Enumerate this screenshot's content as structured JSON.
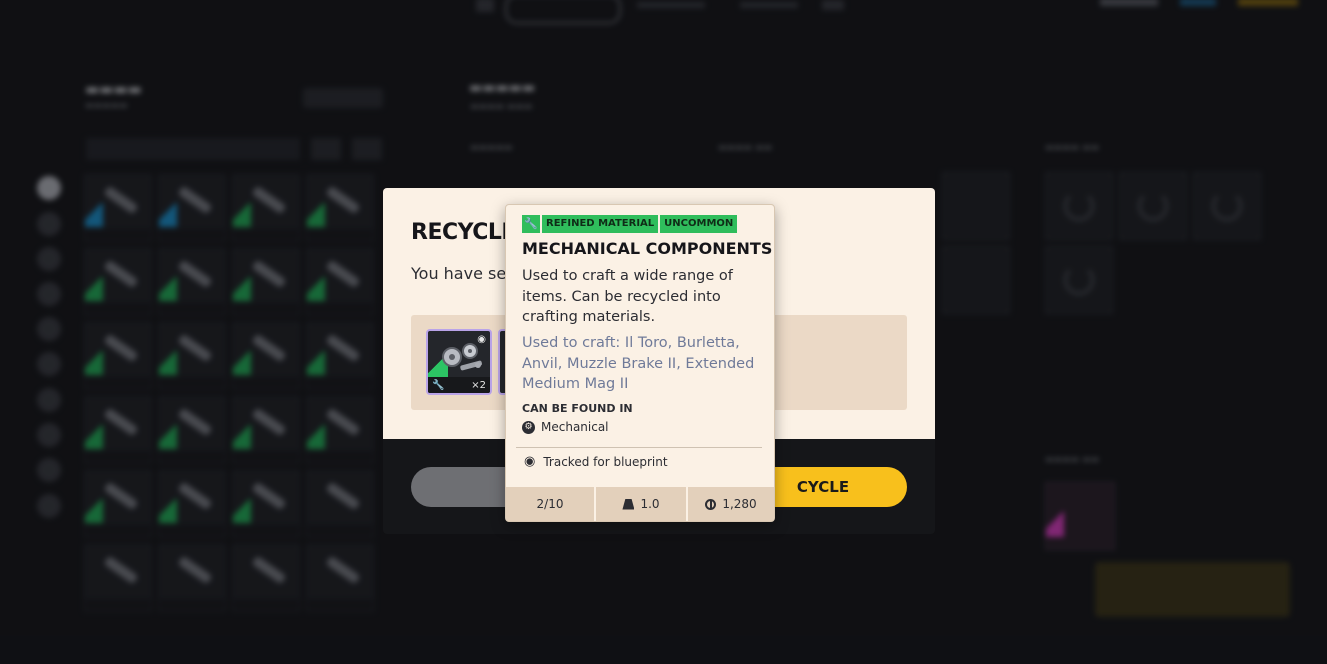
{
  "tooltip": {
    "tags": [
      "REFINED MATERIAL",
      "UNCOMMON"
    ],
    "name": "MECHANICAL COMPONENTS",
    "description": "Used to craft a wide range of items. Can be recycled into crafting materials.",
    "used_to_craft": "Used to craft: Il Toro, Burletta, Anvil, Muzzle Brake II, Extended Medium Mag II",
    "found_in_label": "CAN BE FOUND IN",
    "found_in": "Mechanical",
    "tracked": "Tracked for blueprint",
    "stack": "2/10",
    "weight": "1.0",
    "value": "1,280"
  },
  "dialog": {
    "title": "RECYCLE",
    "description": "You have sel                                           e resources you will get back",
    "recycle_button": "CYCLE",
    "item": {
      "quantity": "×2"
    }
  },
  "colors": {
    "rarity_uncommon": "#2fbd5c",
    "accent_yellow": "#f8c01c",
    "panel_cream": "#fbf1e5"
  }
}
